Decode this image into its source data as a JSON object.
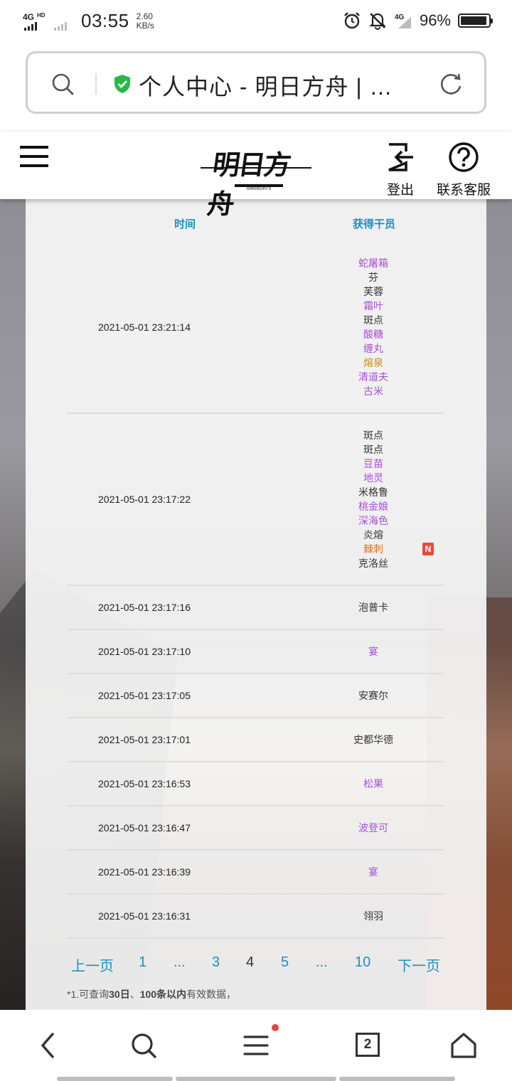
{
  "status_bar": {
    "network_label": "4G",
    "network_sub": "HD",
    "time": "03:55",
    "speed_value": "2.60",
    "speed_unit": "KB/s",
    "network2_label": "4G",
    "battery_percent": "96%",
    "battery_level": 0.96
  },
  "url_bar": {
    "title": "个人中心 - 明日方舟 | …",
    "secure_icon": "shield-check-icon",
    "secure_color": "#2bb84a"
  },
  "header": {
    "logo_text": "明日方舟",
    "logo_sub": "ARKNIGHTS",
    "logout_label": "登出",
    "service_label": "联系客服"
  },
  "table": {
    "col_time": "时间",
    "col_operator": "获得干员",
    "header_color": "#1c8fbf",
    "rows": [
      {
        "time": "2021-05-01 23:21:14",
        "operators": [
          {
            "name": "蛇屠箱",
            "rarity": 4
          },
          {
            "name": "芬",
            "rarity": 3
          },
          {
            "name": "芙蓉",
            "rarity": 3
          },
          {
            "name": "霜叶",
            "rarity": 4
          },
          {
            "name": "斑点",
            "rarity": 3
          },
          {
            "name": "酸糖",
            "rarity": 4
          },
          {
            "name": "缠丸",
            "rarity": 4
          },
          {
            "name": "熔泉",
            "rarity": 5
          },
          {
            "name": "清道夫",
            "rarity": 4
          },
          {
            "name": "古米",
            "rarity": 4
          }
        ]
      },
      {
        "time": "2021-05-01 23:17:22",
        "operators": [
          {
            "name": "斑点",
            "rarity": 3
          },
          {
            "name": "斑点",
            "rarity": 3
          },
          {
            "name": "豆苗",
            "rarity": 4
          },
          {
            "name": "地灵",
            "rarity": 4
          },
          {
            "name": "米格鲁",
            "rarity": 3
          },
          {
            "name": "桃金娘",
            "rarity": 4
          },
          {
            "name": "深海色",
            "rarity": 4
          },
          {
            "name": "炎熔",
            "rarity": 3
          },
          {
            "name": "棘刺",
            "rarity": 6,
            "badge": "N"
          },
          {
            "name": "克洛丝",
            "rarity": 3
          }
        ]
      },
      {
        "time": "2021-05-01 23:17:16",
        "operators": [
          {
            "name": "泡普卡",
            "rarity": 3
          }
        ]
      },
      {
        "time": "2021-05-01 23:17:10",
        "operators": [
          {
            "name": "宴",
            "rarity": 4
          }
        ]
      },
      {
        "time": "2021-05-01 23:17:05",
        "operators": [
          {
            "name": "安赛尔",
            "rarity": 3
          }
        ]
      },
      {
        "time": "2021-05-01 23:17:01",
        "operators": [
          {
            "name": "史都华德",
            "rarity": 3
          }
        ]
      },
      {
        "time": "2021-05-01 23:16:53",
        "operators": [
          {
            "name": "松果",
            "rarity": 4
          }
        ]
      },
      {
        "time": "2021-05-01 23:16:47",
        "operators": [
          {
            "name": "波登可",
            "rarity": 4
          }
        ]
      },
      {
        "time": "2021-05-01 23:16:39",
        "operators": [
          {
            "name": "宴",
            "rarity": 4
          }
        ]
      },
      {
        "time": "2021-05-01 23:16:31",
        "operators": [
          {
            "name": "翎羽",
            "rarity": 3
          }
        ]
      }
    ]
  },
  "pagination": {
    "prev": "上一页",
    "p1": "1",
    "ellipsis1": "...",
    "p3": "3",
    "current": "4",
    "p5": "5",
    "ellipsis2": "...",
    "p10": "10",
    "next": "下一页"
  },
  "note": {
    "prefix": "*1.可查询",
    "days": "30日",
    "sep": "、",
    "count": "100条以内",
    "suffix": "有效数据，"
  },
  "bottom_nav": {
    "tab_count": "2",
    "icons": [
      "back-icon",
      "search-icon",
      "menu-icon",
      "tabs-icon",
      "home-icon"
    ]
  }
}
